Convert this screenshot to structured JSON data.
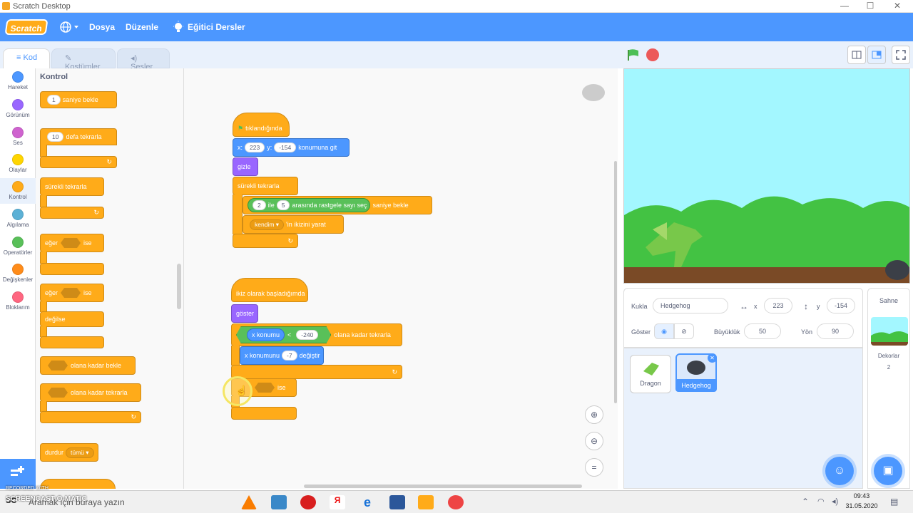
{
  "window": {
    "title": "Scratch Desktop",
    "minimize": "—",
    "maximize": "☐",
    "close": "✕"
  },
  "menubar": {
    "logo": "Scratch",
    "language_icon": "globe-icon",
    "file": "Dosya",
    "edit": "Düzenle",
    "tutorials": "Eğitici Dersler"
  },
  "tabs": {
    "code": "Kod",
    "costumes": "Kostümler",
    "sounds": "Sesler"
  },
  "categories": [
    {
      "label": "Hareket",
      "color": "#4c97ff"
    },
    {
      "label": "Görünüm",
      "color": "#9966ff"
    },
    {
      "label": "Ses",
      "color": "#cf63cf"
    },
    {
      "label": "Olaylar",
      "color": "#ffd500"
    },
    {
      "label": "Kontrol",
      "color": "#ffab19"
    },
    {
      "label": "Algılama",
      "color": "#5cb1d6"
    },
    {
      "label": "Operatörler",
      "color": "#59c059"
    },
    {
      "label": "Değişkenler",
      "color": "#ff8c1a"
    },
    {
      "label": "Bloklarım",
      "color": "#ff6680"
    }
  ],
  "palette": {
    "title": "Kontrol",
    "wait_val": "1",
    "wait_label": "saniye bekle",
    "repeat_val": "10",
    "repeat_label": "defa tekrarla",
    "forever": "sürekli tekrarla",
    "if": "eğer",
    "then": "ise",
    "if2": "eğer",
    "then2": "ise",
    "else": "değilse",
    "wait_until": "olana kadar bekle",
    "repeat_until": "olana kadar tekrarla",
    "stop": "durdur",
    "stop_opt": "tümü ▾"
  },
  "script1": {
    "hat": "tıklandığında",
    "goto_x_label": "x:",
    "goto_x": "223",
    "goto_y_label": "y:",
    "goto_y": "-154",
    "goto_label": "konumuna git",
    "hide": "gizle",
    "forever": "sürekli tekrarla",
    "rand_a": "2",
    "rand_and": "ile",
    "rand_b": "5",
    "rand_label": "arasında rastgele sayı seç",
    "wait_label": "saniye bekle",
    "clone_target": "kendim ▾",
    "clone_label": "'in ikizini yarat"
  },
  "script2": {
    "hat": "ikiz olarak başladığımda",
    "show": "göster",
    "cond_left": "x konumu",
    "cond_op": "<",
    "cond_right": "-240",
    "repeat_until": "olana kadar tekrarla",
    "change_label": "x konumunu",
    "change_val": "-7",
    "change_suffix": "değiştir",
    "if_then": "ise"
  },
  "stage_header": {
    "flag_icon": "green-flag-icon",
    "stop_icon": "stop-icon"
  },
  "sprite_info": {
    "sprite_label": "Kukla",
    "sprite_name": "Hedgehog",
    "x_label": "x",
    "x_val": "223",
    "y_label": "y",
    "y_val": "-154",
    "show_label": "Göster",
    "size_label": "Büyüklük",
    "size_val": "50",
    "direction_label": "Yön",
    "direction_val": "90"
  },
  "sprites": [
    {
      "name": "Dragon"
    },
    {
      "name": "Hedgehog",
      "selected": true
    }
  ],
  "stage_panel": {
    "title": "Sahne",
    "backdrops_label": "Dekorlar",
    "backdrops_count": "2"
  },
  "taskbar": {
    "search_placeholder": "Aramak için buraya yazın",
    "time": "09:43",
    "date": "31.05.2020"
  },
  "watermark": {
    "line1": "RECORDED WITH",
    "line2": "SCREENCAST-O-MATIC"
  }
}
